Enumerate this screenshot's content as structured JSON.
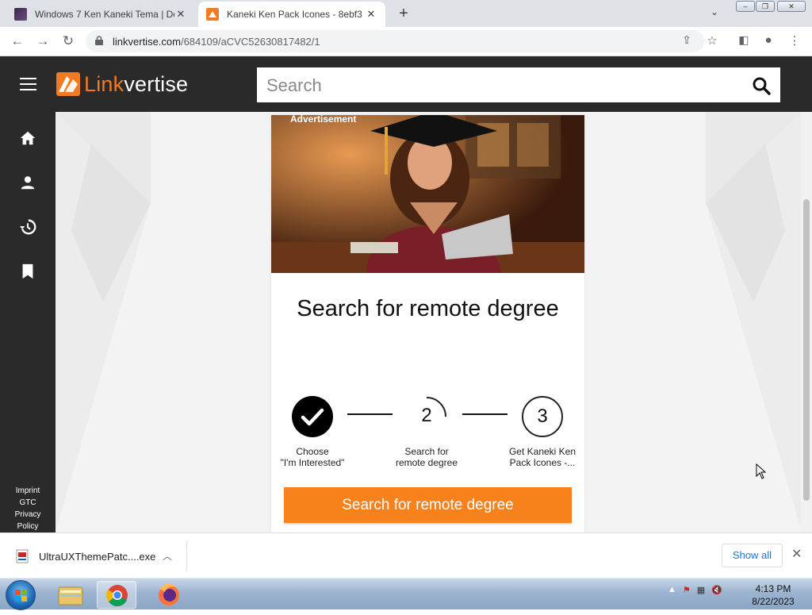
{
  "browser": {
    "tabs": [
      {
        "title": "Windows 7 Ken Kaneki Tema | De",
        "active": false
      },
      {
        "title": "Kaneki Ken Pack Icones - 8ebf3 -",
        "active": true
      }
    ],
    "url_domain": "linkvertise.com",
    "url_path": "/684109/aCVC52630817482/1"
  },
  "header": {
    "logo_link": "Link",
    "logo_vertise": "vertise",
    "search_placeholder": "Search"
  },
  "sidebar": {
    "icons": [
      "home-icon",
      "account-icon",
      "history-icon",
      "bookmark-icon"
    ],
    "footer_links": [
      "Imprint",
      "GTC",
      "Privacy",
      "Policy"
    ]
  },
  "card": {
    "ad_label": "Advertisement",
    "title": "Search for remote degree",
    "steps": [
      {
        "number": "",
        "label_line1": "Choose",
        "label_line2": "\"I'm Interested\"",
        "state": "done"
      },
      {
        "number": "2",
        "label_line1": "Search for",
        "label_line2": "remote degree",
        "state": "in-progress"
      },
      {
        "number": "3",
        "label_line1": "Get Kaneki Ken",
        "label_line2": "Pack Icones -...",
        "state": "pending"
      }
    ],
    "cta_label": "Search for remote degree"
  },
  "download_bar": {
    "file_name": "UltraUXThemePatc....exe",
    "show_all_label": "Show all"
  },
  "taskbar": {
    "time": "4:13 PM",
    "date": "8/22/2023"
  },
  "colors": {
    "brand_orange": "#f7821b",
    "header_dark": "#2a2a2a",
    "chrome_tabstrip": "#dee1e6",
    "link_blue": "#1a73e8"
  }
}
